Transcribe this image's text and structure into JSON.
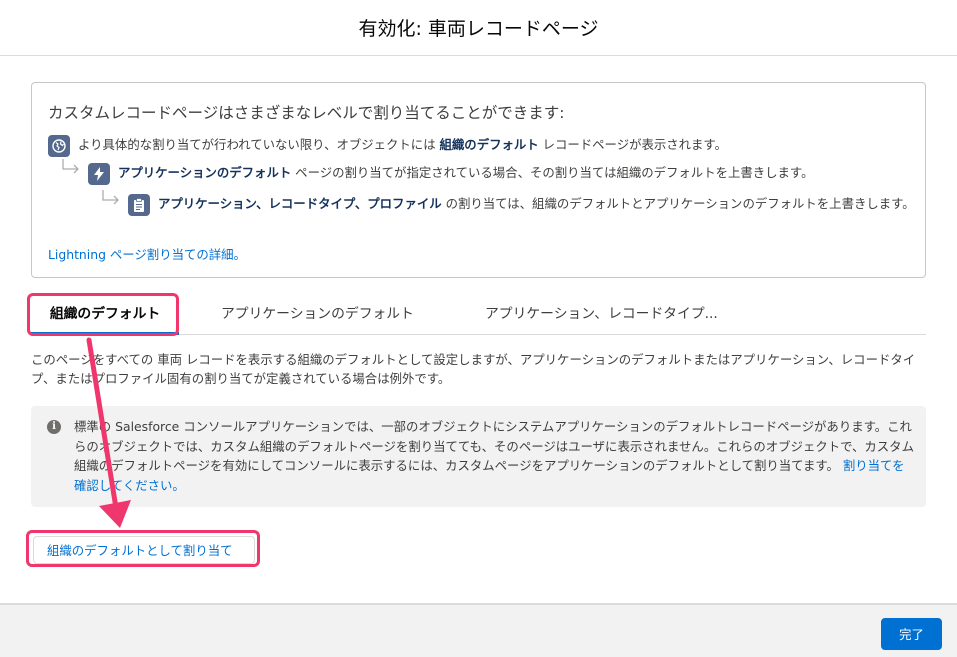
{
  "modal": {
    "title": "有効化: 車両レコードページ"
  },
  "info": {
    "heading": "カスタムレコードページはさまざまなレベルで割り当てることができます:",
    "row1": {
      "pre": "より具体的な割り当てが行われていない限り、オブジェクトには ",
      "bold": "組織のデフォルト",
      "post": " レコードページが表示されます。",
      "icon": "globe-icon"
    },
    "row2": {
      "bold": "アプリケーションのデフォルト",
      "post": " ページの割り当てが指定されている場合、その割り当ては組織のデフォルトを上書きします。",
      "icon": "lightning-icon"
    },
    "row3": {
      "bold": "アプリケーション、レコードタイプ、プロファイル",
      "post": " の割り当ては、組織のデフォルトとアプリケーションのデフォルトを上書きします。",
      "icon": "clipboard-icon"
    },
    "link": "Lightning ページ割り当ての詳細。"
  },
  "tabs": [
    {
      "label": "組織のデフォルト",
      "active": true
    },
    {
      "label": "アプリケーションのデフォルト",
      "active": false
    },
    {
      "label": "アプリケーション、レコードタイプ...",
      "active": false
    }
  ],
  "description": "このページをすべての 車両 レコードを表示する組織のデフォルトとして設定しますが、アプリケーションのデフォルトまたはアプリケーション、レコードタイプ、またはプロファイル固有の割り当てが定義されている場合は例外です。",
  "notice": {
    "icon": "info-icon",
    "text": "標準の Salesforce コンソールアプリケーションでは、一部のオブジェクトにシステムアプリケーションのデフォルトレコードページがあります。これらのオブジェクトでは、カスタム組織のデフォルトページを割り当てても、そのページはユーザに表示されません。これらのオブジェクトで、カスタム組織のデフォルトページを有効にしてコンソールに表示するには、カスタムページをアプリケーションのデフォルトとして割り当てます。",
    "link": "割り当てを確認してください。"
  },
  "assign_button": "組織のデフォルトとして割り当て",
  "footer": {
    "done_label": "完了"
  },
  "colors": {
    "accent": "#0070d2",
    "highlight": "#f0376d",
    "icon_bg": "#54698d"
  }
}
